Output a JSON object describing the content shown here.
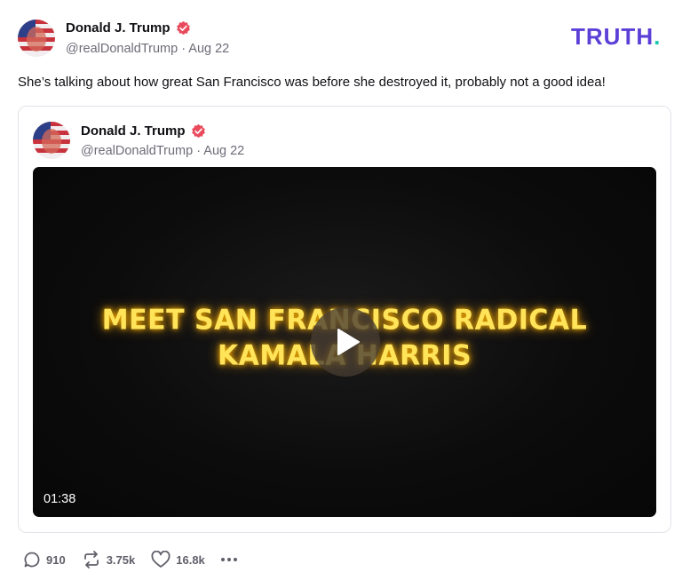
{
  "brand": {
    "word": "TRUTH",
    "dot": ".",
    "colors": {
      "word": "#5b3fd6",
      "dot": "#16c7b0"
    }
  },
  "post": {
    "author_name": "Donald J. Trump",
    "handle": "@realDonaldTrump",
    "date": "Aug 22",
    "meta": "@realDonaldTrump · Aug 22",
    "text": "She’s talking about how great San Francisco was before she destroyed it, probably not a good idea!",
    "verified_color": "#e94a5c"
  },
  "quoted_post": {
    "author_name": "Donald J. Trump",
    "meta": "@realDonaldTrump · Aug 22",
    "video": {
      "title_line1": "MEET SAN FRANCISCO RADICAL",
      "title_line2": "KAMALA HARRIS",
      "duration": "01:38"
    }
  },
  "actions": {
    "replies": "910",
    "retruths": "3.75k",
    "likes": "16.8k"
  },
  "icons": [
    "verified-badge-icon",
    "play-icon",
    "reply-icon",
    "retruth-icon",
    "like-icon",
    "more-icon"
  ]
}
